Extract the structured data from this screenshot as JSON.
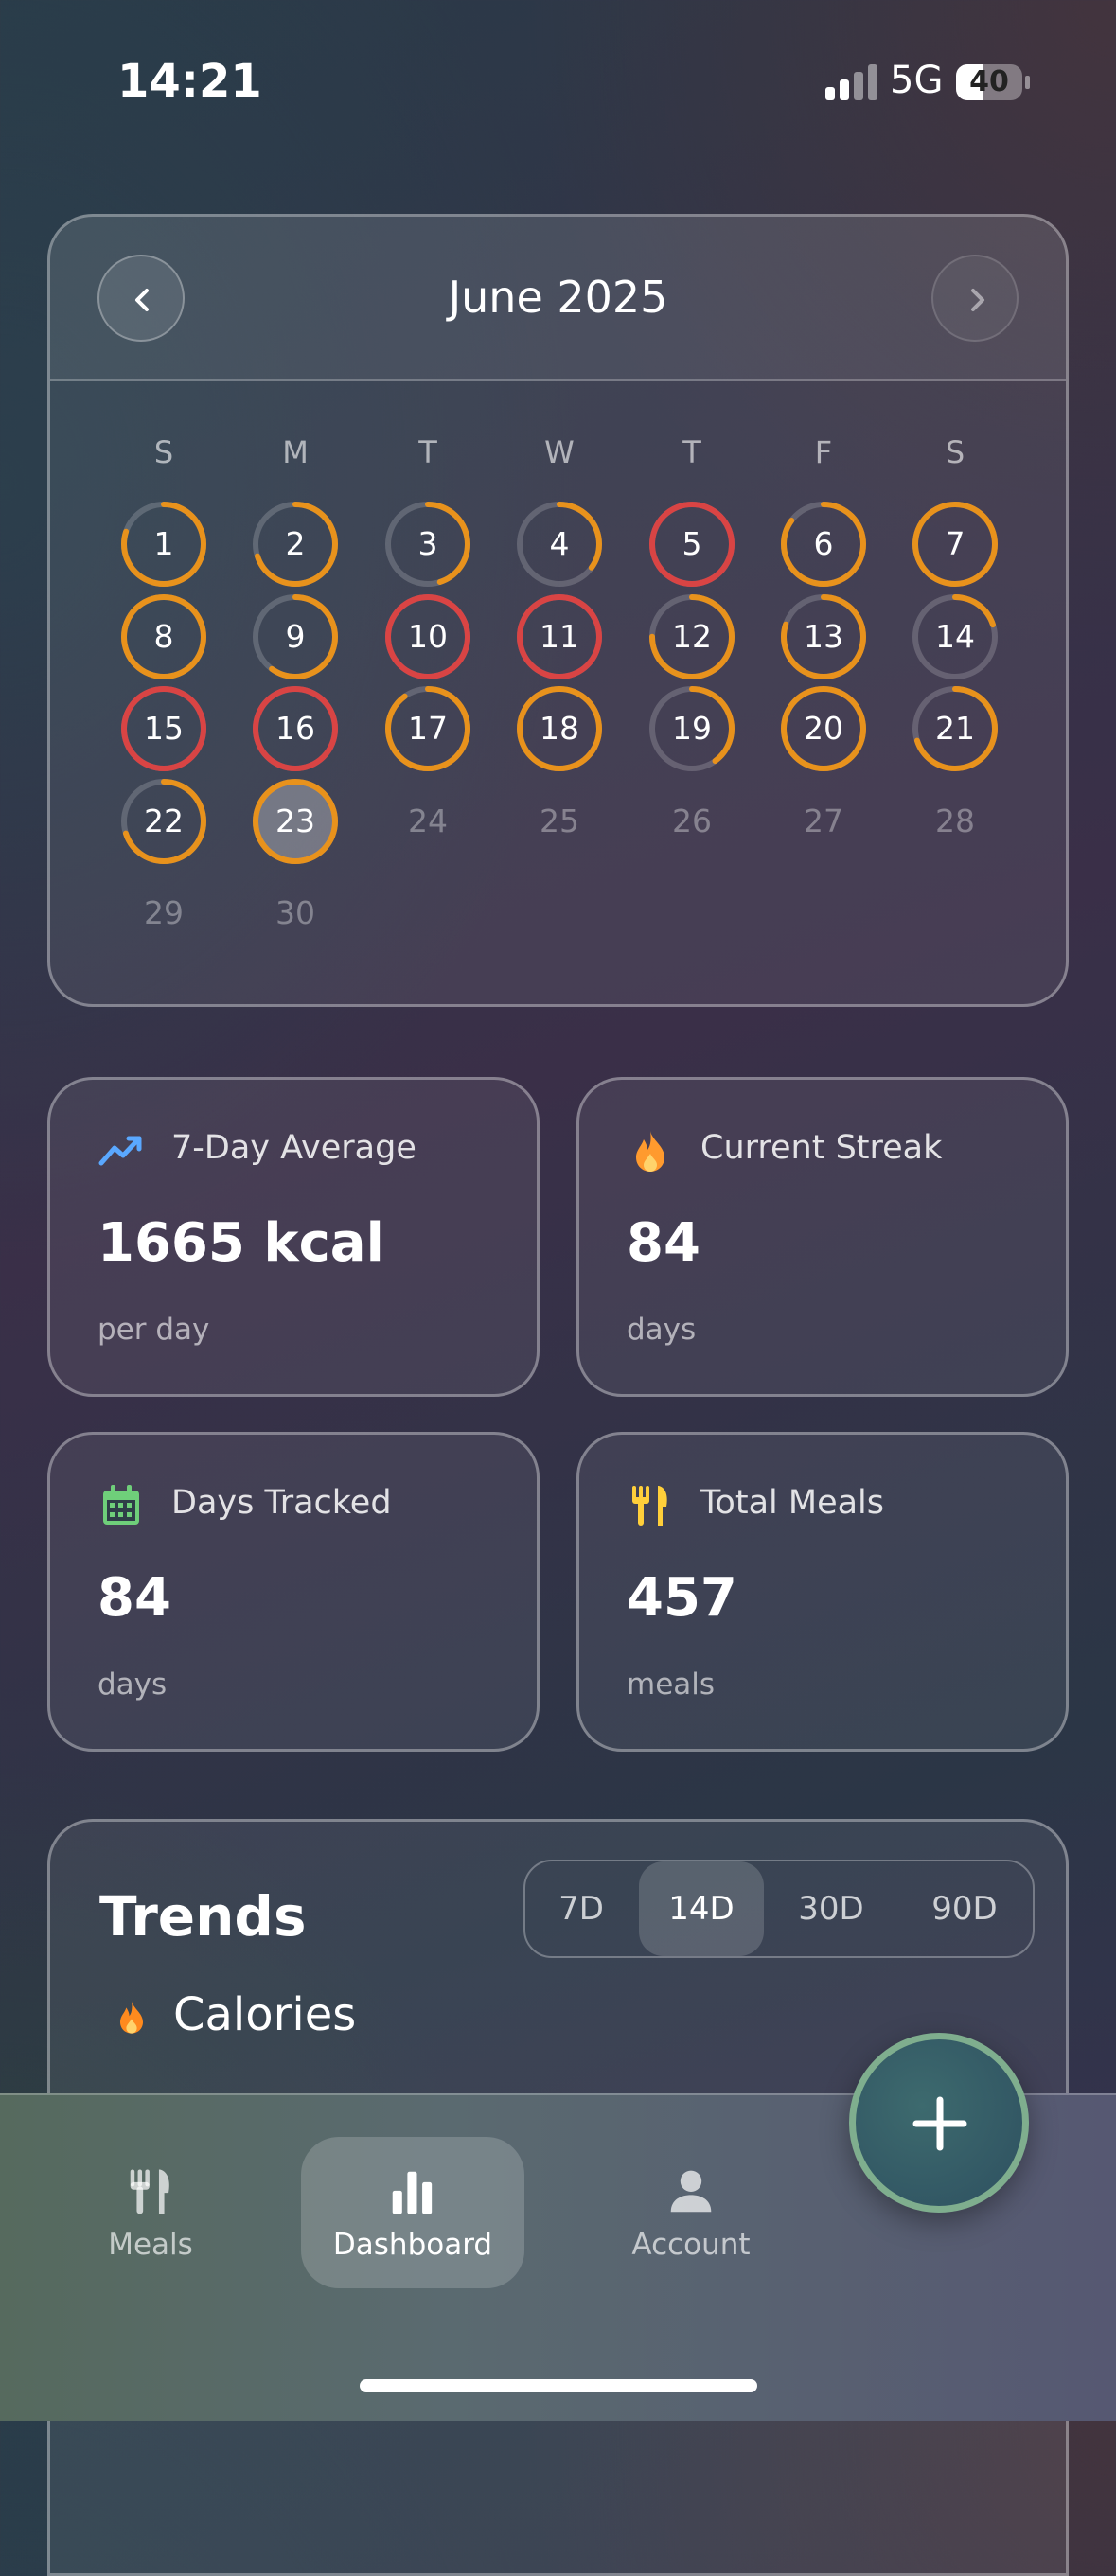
{
  "status": {
    "time": "14:21",
    "network": "5G",
    "battery": "40",
    "battery_fraction": 0.4
  },
  "calendar": {
    "title": "June 2025",
    "weekdays": [
      "S",
      "M",
      "T",
      "W",
      "T",
      "F",
      "S"
    ],
    "days": [
      {
        "n": "1",
        "state": "logged",
        "progress": 0.8,
        "color": "#e8921c"
      },
      {
        "n": "2",
        "state": "logged",
        "progress": 0.7,
        "color": "#e8921c"
      },
      {
        "n": "3",
        "state": "logged",
        "progress": 0.45,
        "color": "#e8921c"
      },
      {
        "n": "4",
        "state": "logged",
        "progress": 0.35,
        "color": "#e8921c"
      },
      {
        "n": "5",
        "state": "over",
        "progress": 1,
        "color": "#d94444"
      },
      {
        "n": "6",
        "state": "logged",
        "progress": 0.85,
        "color": "#e8921c"
      },
      {
        "n": "7",
        "state": "logged",
        "progress": 1,
        "color": "#e8921c"
      },
      {
        "n": "8",
        "state": "logged",
        "progress": 1,
        "color": "#e8921c"
      },
      {
        "n": "9",
        "state": "logged",
        "progress": 0.6,
        "color": "#e8921c"
      },
      {
        "n": "10",
        "state": "over",
        "progress": 1,
        "color": "#d94444"
      },
      {
        "n": "11",
        "state": "over",
        "progress": 1,
        "color": "#d94444"
      },
      {
        "n": "12",
        "state": "logged",
        "progress": 0.75,
        "color": "#e8921c"
      },
      {
        "n": "13",
        "state": "logged",
        "progress": 0.8,
        "color": "#e8921c"
      },
      {
        "n": "14",
        "state": "logged",
        "progress": 0.2,
        "color": "#e8921c"
      },
      {
        "n": "15",
        "state": "over",
        "progress": 1,
        "color": "#d94444"
      },
      {
        "n": "16",
        "state": "over",
        "progress": 1,
        "color": "#d94444"
      },
      {
        "n": "17",
        "state": "logged",
        "progress": 0.9,
        "color": "#e8921c"
      },
      {
        "n": "18",
        "state": "logged",
        "progress": 1,
        "color": "#e8921c"
      },
      {
        "n": "19",
        "state": "logged",
        "progress": 0.4,
        "color": "#e8921c"
      },
      {
        "n": "20",
        "state": "logged",
        "progress": 1,
        "color": "#e8921c"
      },
      {
        "n": "21",
        "state": "logged",
        "progress": 0.7,
        "color": "#e8921c"
      },
      {
        "n": "22",
        "state": "logged",
        "progress": 0.7,
        "color": "#e8921c"
      },
      {
        "n": "23",
        "state": "today",
        "progress": 1,
        "color": "#e8921c"
      },
      {
        "n": "24",
        "state": "future"
      },
      {
        "n": "25",
        "state": "future"
      },
      {
        "n": "26",
        "state": "future"
      },
      {
        "n": "27",
        "state": "future"
      },
      {
        "n": "28",
        "state": "future"
      },
      {
        "n": "29",
        "state": "future"
      },
      {
        "n": "30",
        "state": "future"
      }
    ]
  },
  "stats": {
    "avg": {
      "title": "7-Day Average",
      "value": "1665 kcal",
      "unit": "per day",
      "icon": "trending-up-icon",
      "color": "#5aa8ff"
    },
    "streak": {
      "title": "Current Streak",
      "value": "84",
      "unit": "days",
      "icon": "flame-icon",
      "color": "#ff9a2e"
    },
    "tracked": {
      "title": "Days Tracked",
      "value": "84",
      "unit": "days",
      "icon": "calendar-icon",
      "color": "#6fcf7a"
    },
    "meals": {
      "title": "Total Meals",
      "value": "457",
      "unit": "meals",
      "icon": "utensils-icon",
      "color": "#ffcf3a"
    }
  },
  "trends": {
    "title": "Trends",
    "ranges": [
      "7D",
      "14D",
      "30D",
      "90D"
    ],
    "selected": "14D",
    "metric": "Calories"
  },
  "tabs": [
    {
      "label": "Meals",
      "icon": "utensils-icon",
      "active": false
    },
    {
      "label": "Dashboard",
      "icon": "bar-chart-icon",
      "active": true
    },
    {
      "label": "Account",
      "icon": "person-icon",
      "active": false
    }
  ],
  "fab": {
    "icon": "plus-icon"
  }
}
